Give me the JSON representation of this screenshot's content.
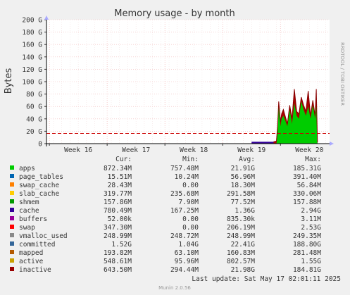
{
  "chart_data": {
    "type": "area",
    "title": "Memory usage - by month",
    "ylabel": "Bytes",
    "side_label": "RRDTOOL / TOBI OETIKER",
    "y_ticks": [
      {
        "label": "200 G",
        "value": 200
      },
      {
        "label": "180 G",
        "value": 180
      },
      {
        "label": "160 G",
        "value": 160
      },
      {
        "label": "140 G",
        "value": 140
      },
      {
        "label": "120 G",
        "value": 120
      },
      {
        "label": "100 G",
        "value": 100
      },
      {
        "label": "80 G",
        "value": 80
      },
      {
        "label": "60 G",
        "value": 60
      },
      {
        "label": "40 G",
        "value": 40
      },
      {
        "label": "20 G",
        "value": 20
      },
      {
        "label": "0",
        "value": 0
      }
    ],
    "ylim": [
      0,
      200
    ],
    "x_ticks": [
      {
        "label": "Week 16",
        "value": 16
      },
      {
        "label": "Week 17",
        "value": 17
      },
      {
        "label": "Week 18",
        "value": 18
      },
      {
        "label": "Week 19",
        "value": 19
      },
      {
        "label": "Week 20",
        "value": 20
      }
    ],
    "xlim": [
      15.45,
      20.35
    ],
    "reference_line": {
      "value": 16.5,
      "color": "#cc0000"
    },
    "apps_series": {
      "name": "apps",
      "color": "#00cc00",
      "x": [
        19.38,
        19.43,
        19.45,
        19.47,
        19.5,
        19.52,
        19.55,
        19.58,
        19.62,
        19.66,
        19.7,
        19.74,
        19.78,
        19.82,
        19.86,
        19.9,
        19.94,
        19.98,
        20.02,
        20.06,
        20.1,
        20.12,
        20.14
      ],
      "y": [
        0,
        0,
        20,
        62,
        28,
        40,
        45,
        38,
        28,
        55,
        32,
        65,
        45,
        40,
        68,
        55,
        45,
        60,
        40,
        62,
        40,
        62,
        0
      ]
    },
    "swap_series": {
      "name": "swap",
      "color": "#aa0000",
      "x": [
        19.38,
        19.43,
        19.45,
        19.47,
        19.5,
        19.52,
        19.55,
        19.58,
        19.62,
        19.66,
        19.7,
        19.74,
        19.78,
        19.82,
        19.86,
        19.9,
        19.94,
        19.98,
        20.02,
        20.06,
        20.1,
        20.12,
        20.14
      ],
      "y": [
        3,
        4,
        28,
        68,
        35,
        48,
        55,
        45,
        32,
        62,
        40,
        88,
        52,
        48,
        75,
        62,
        52,
        85,
        45,
        70,
        45,
        88,
        2
      ]
    },
    "cache_band": {
      "name": "cache",
      "color": "#330099",
      "x_start": 19.0,
      "x_end": 19.42,
      "value": 3
    },
    "legend_header": {
      "cur": "Cur:",
      "min": "Min:",
      "avg": "Avg:",
      "max": "Max:"
    },
    "legend": [
      {
        "name": "apps",
        "color": "#00cc00",
        "cur": "872.34M",
        "min": "757.48M",
        "avg": "21.91G",
        "max": "185.31G"
      },
      {
        "name": "page_tables",
        "color": "#0066b3",
        "cur": "15.51M",
        "min": "10.24M",
        "avg": "56.96M",
        "max": "391.40M"
      },
      {
        "name": "swap_cache",
        "color": "#ff8000",
        "cur": "28.43M",
        "min": "0.00",
        "avg": "18.30M",
        "max": "56.84M"
      },
      {
        "name": "slab_cache",
        "color": "#ffcc00",
        "cur": "319.77M",
        "min": "235.68M",
        "avg": "291.58M",
        "max": "330.06M"
      },
      {
        "name": "shmem",
        "color": "#009900",
        "cur": "157.86M",
        "min": "7.90M",
        "avg": "77.52M",
        "max": "157.88M"
      },
      {
        "name": "cache",
        "color": "#330099",
        "cur": "780.49M",
        "min": "167.25M",
        "avg": "1.36G",
        "max": "2.94G"
      },
      {
        "name": "buffers",
        "color": "#990099",
        "cur": "52.00k",
        "min": "0.00",
        "avg": "835.30k",
        "max": "3.11M"
      },
      {
        "name": "swap",
        "color": "#ff0000",
        "cur": "347.30M",
        "min": "0.00",
        "avg": "206.19M",
        "max": "2.53G"
      },
      {
        "name": "vmalloc_used",
        "color": "#888888",
        "cur": "248.99M",
        "min": "248.72M",
        "avg": "248.99M",
        "max": "249.35M"
      },
      {
        "name": "committed",
        "color": "#336699",
        "cur": "1.52G",
        "min": "1.04G",
        "avg": "22.41G",
        "max": "188.80G"
      },
      {
        "name": "mapped",
        "color": "#b35900",
        "cur": "193.82M",
        "min": "63.10M",
        "avg": "160.83M",
        "max": "281.48M"
      },
      {
        "name": "active",
        "color": "#c8a000",
        "cur": "548.61M",
        "min": "95.96M",
        "avg": "802.57M",
        "max": "1.55G"
      },
      {
        "name": "inactive",
        "color": "#990000",
        "cur": "643.50M",
        "min": "294.44M",
        "avg": "21.98G",
        "max": "184.81G"
      }
    ],
    "last_update": "Last update: Sat May 17 02:01:11 2025",
    "footer": "Munin 2.0.56"
  }
}
